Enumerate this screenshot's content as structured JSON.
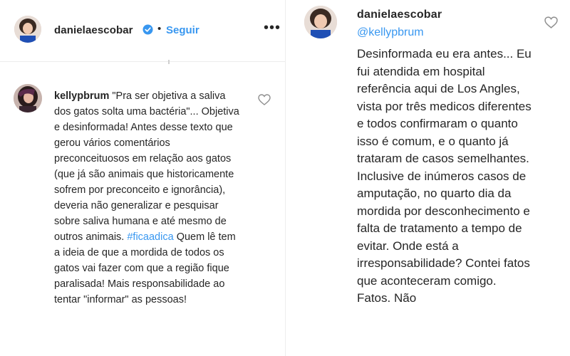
{
  "left_post": {
    "username": "danielaescobar",
    "separator": "•",
    "follow_label": "Seguir",
    "more_label": "•••",
    "comment": {
      "username": "kellypbrum",
      "text_before_tag": "\"Pra ser objetiva a saliva dos gatos solta uma bactéria\"... Objetiva e desinformada! Antes desse texto que gerou vários comentários preconceituosos em relação aos gatos (que já são animais que historicamente sofrem por preconceito e ignorância), deveria não generalizar e pesquisar sobre saliva humana e até mesmo de outros animais.",
      "hashtag": "#ficaadica",
      "text_after_tag": "Quem lê tem a ideia de que a mordida de todos os gatos vai fazer com que a região fique paralisada! Mais responsabilidade ao tentar \"informar\" as pessoas!"
    }
  },
  "right_post": {
    "reply": {
      "username": "danielaescobar",
      "mention": "@kellypbrum",
      "text": "Desinformada eu era antes... Eu fui atendida em hospital referência aqui de Los Angles, vista por três medicos diferentes e todos confirmaram o quanto isso é comum, e o quanto já trataram de casos semelhantes. Inclusive de inúmeros casos de amputação, no quarto dia da mordida por desconhecimento e falta de tratamento a tempo de evitar. Onde está a irresponsabilidade? Contei fatos que aconteceram comigo. Fatos. Não"
    }
  },
  "colors": {
    "link_blue": "#3897f0",
    "text_dark": "#262626",
    "verified_blue": "#3897f0"
  },
  "icons": [
    "verified-badge-icon",
    "heart-icon",
    "more-options-icon"
  ]
}
